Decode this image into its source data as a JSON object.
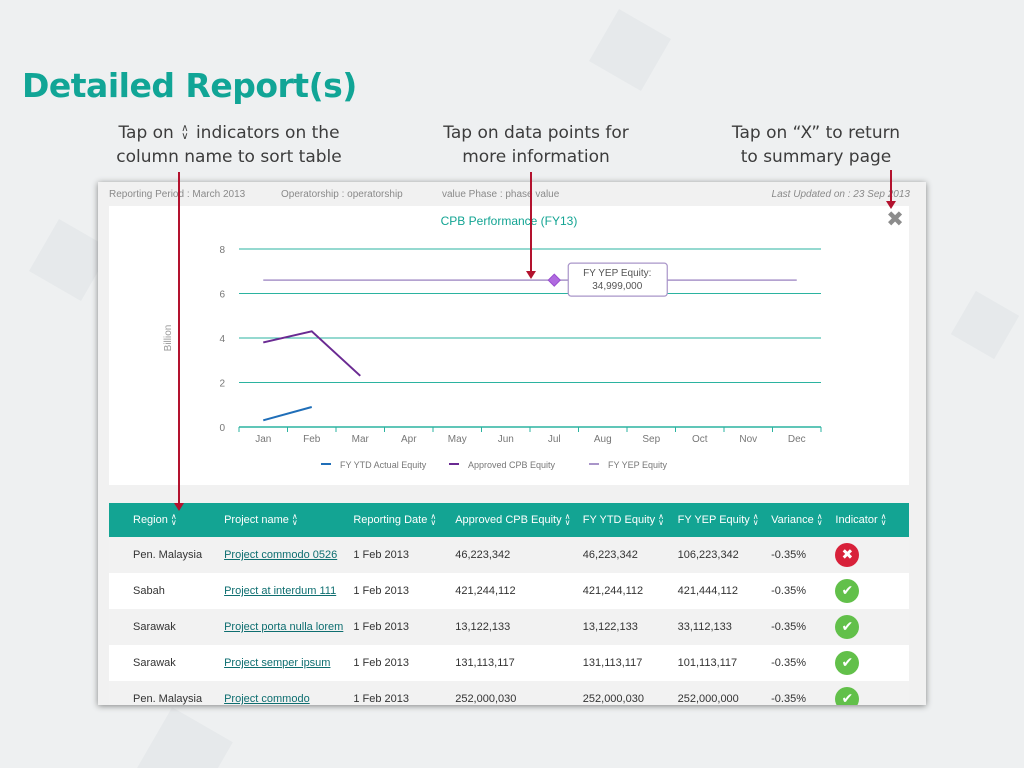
{
  "slide": {
    "title": "Detailed Report(s)",
    "annotations": {
      "sort": {
        "line1_pre": "Tap on",
        "line1_post": "indicators on the",
        "line2": "column name  to sort table"
      },
      "datapoint": {
        "line1": "Tap on data points for",
        "line2": "more information"
      },
      "close": {
        "line1": "Tap on “X” to return",
        "line2": "to summary page"
      }
    }
  },
  "report": {
    "header": {
      "reporting_period": "Reporting Period : March 2013",
      "operatorship": "Operatorship : operatorship",
      "value_phase": "value Phase : phase value",
      "last_updated": "Last Updated on : 23 Sep 2013"
    },
    "close_label": "✖",
    "tooltip": {
      "line1": "FY YEP Equity:",
      "line2": "34,999,000"
    }
  },
  "chart_data": {
    "type": "line",
    "title": "CPB Performance (FY13)",
    "xlabel": "",
    "ylabel": "Billion",
    "categories": [
      "Jan",
      "Feb",
      "Mar",
      "Apr",
      "May",
      "Jun",
      "Jul",
      "Aug",
      "Sep",
      "Oct",
      "Nov",
      "Dec"
    ],
    "ylim": [
      0,
      8
    ],
    "yticks": [
      0,
      2,
      4,
      6,
      8
    ],
    "grid": true,
    "legend_position": "bottom",
    "series": [
      {
        "name": "FY YTD Actual Equity",
        "color": "#1f6eb8",
        "values": [
          0.3,
          0.9
        ]
      },
      {
        "name": "Approved CPB Equity",
        "color": "#6a2a92",
        "values": [
          3.8,
          4.3,
          2.3
        ]
      },
      {
        "name": "FY YEP Equity",
        "color": "#a995c9",
        "values": [
          6.6,
          6.6,
          6.6,
          6.6,
          6.6,
          6.6,
          6.6,
          6.6,
          6.6,
          6.6,
          6.6,
          6.6
        ]
      }
    ],
    "highlight_point": {
      "series": "FY YEP Equity",
      "category": "Jul",
      "value": 6.6
    },
    "colors": {
      "grid": "#2bb3a0",
      "axis": "#2bb3a0",
      "tick_text": "#777777"
    }
  },
  "table": {
    "columns": [
      "Region",
      "Project name",
      "Reporting Date",
      "Approved CPB Equity",
      "FY YTD Equity",
      "FY YEP Equity",
      "Variance",
      "Indicator"
    ],
    "sort_icon": "up-down-chevron-icon",
    "rows": [
      {
        "region": "Pen. Malaysia",
        "project": "Project commodo 0526",
        "date": "1 Feb 2013",
        "approved": "46,223,342",
        "ytd": "46,223,342",
        "yep": "106,223,342",
        "variance": "-0.35%",
        "indicator": "error",
        "indicator_glyph": "✖"
      },
      {
        "region": "Sabah",
        "project": "Project  at interdum 111",
        "date": "1 Feb 2013",
        "approved": "421,244,112",
        "ytd": "421,244,112",
        "yep": "421,444,112",
        "variance": "-0.35%",
        "indicator": "ok",
        "indicator_glyph": "✔"
      },
      {
        "region": "Sarawak",
        "project": "Project porta nulla lorem",
        "date": "1 Feb 2013",
        "approved": "13,122,133",
        "ytd": "13,122,133",
        "yep": "33,112,133",
        "variance": "-0.35%",
        "indicator": "ok",
        "indicator_glyph": "✔"
      },
      {
        "region": "Sarawak",
        "project": "Project semper ipsum",
        "date": "1 Feb 2013",
        "approved": "131,113,117",
        "ytd": "131,113,117",
        "yep": "101,113,117",
        "variance": "-0.35%",
        "indicator": "ok",
        "indicator_glyph": "✔"
      },
      {
        "region": "Pen. Malaysia",
        "project": "Project commodo",
        "date": "1 Feb 2013",
        "approved": "252,000,030",
        "ytd": "252,000,030",
        "yep": "252,000,000",
        "variance": "-0.35%",
        "indicator": "ok",
        "indicator_glyph": "✔"
      }
    ]
  },
  "colors": {
    "accent": "#13a493",
    "title": "#11a596",
    "annotation_arrow": "#b3122e",
    "error": "#d8213a",
    "success": "#62c04a"
  }
}
